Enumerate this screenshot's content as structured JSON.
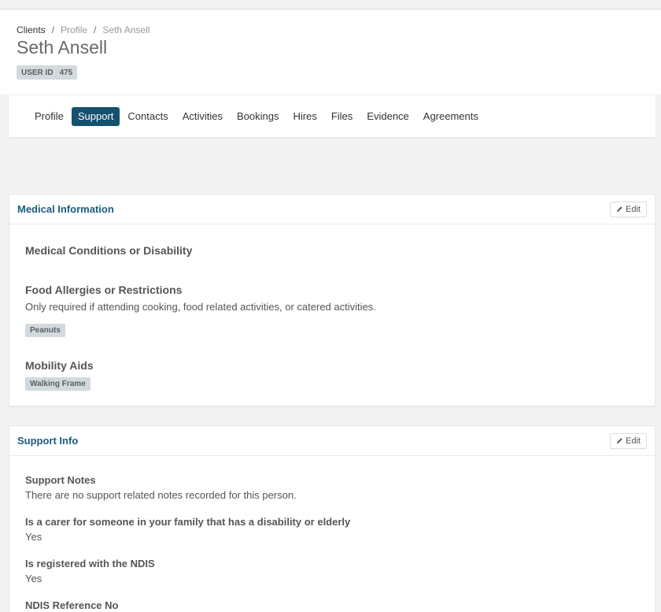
{
  "breadcrumb": {
    "clients": "Clients",
    "profile": "Profile",
    "current": "Seth Ansell",
    "separator": "/"
  },
  "header": {
    "title": "Seth Ansell",
    "user_id_label": "USER ID",
    "user_id_value": "475"
  },
  "tabs": [
    {
      "label": "Profile",
      "active": false
    },
    {
      "label": "Support",
      "active": true
    },
    {
      "label": "Contacts",
      "active": false
    },
    {
      "label": "Activities",
      "active": false
    },
    {
      "label": "Bookings",
      "active": false
    },
    {
      "label": "Hires",
      "active": false
    },
    {
      "label": "Files",
      "active": false
    },
    {
      "label": "Evidence",
      "active": false
    },
    {
      "label": "Agreements",
      "active": false
    }
  ],
  "medical": {
    "title": "Medical Information",
    "edit_label": "Edit",
    "conditions_heading": "Medical Conditions or Disability",
    "allergies_heading": "Food Allergies or Restrictions",
    "allergies_note": "Only required if attending cooking, food related activities, or catered activities.",
    "allergy_tag": "Peanuts",
    "mobility_heading": "Mobility Aids",
    "mobility_tag": "Walking Frame"
  },
  "support": {
    "title": "Support Info",
    "edit_label": "Edit",
    "notes_label": "Support Notes",
    "notes_value": "There are no support related notes recorded for this person.",
    "carer_label": "Is a carer for someone in your family that has a disability or elderly",
    "carer_value": "Yes",
    "ndis_label": "Is registered with the NDIS",
    "ndis_value": "Yes",
    "ndis_ref_label": "NDIS Reference No"
  },
  "colors": {
    "accent": "#15506f",
    "card_title": "#1b5c7e",
    "badge_bg": "#d1dade"
  }
}
